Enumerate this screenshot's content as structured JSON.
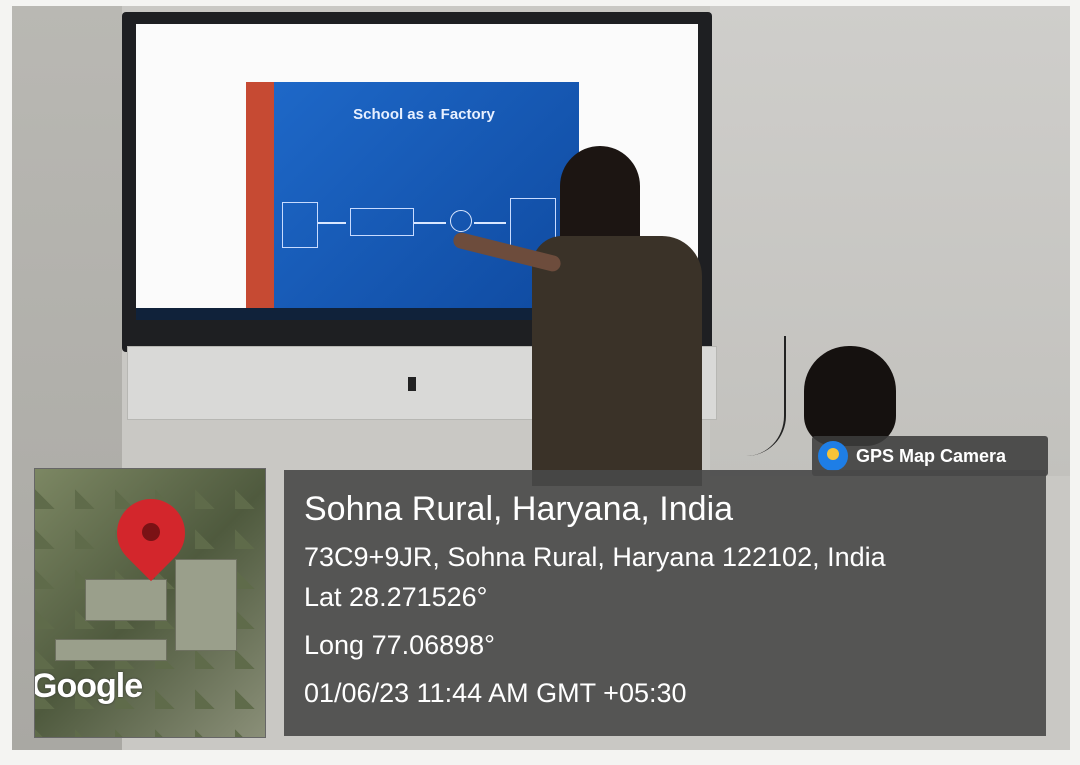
{
  "slide": {
    "title": "School as a Factory"
  },
  "map": {
    "watermark": "Google"
  },
  "gps": {
    "badge": "GPS Map Camera",
    "place": "Sohna Rural, Haryana, India",
    "address": "73C9+9JR, Sohna Rural, Haryana 122102, India",
    "lat": "Lat 28.271526°",
    "long": "Long 77.06898°",
    "datetime": "01/06/23 11:44 AM GMT +05:30"
  }
}
